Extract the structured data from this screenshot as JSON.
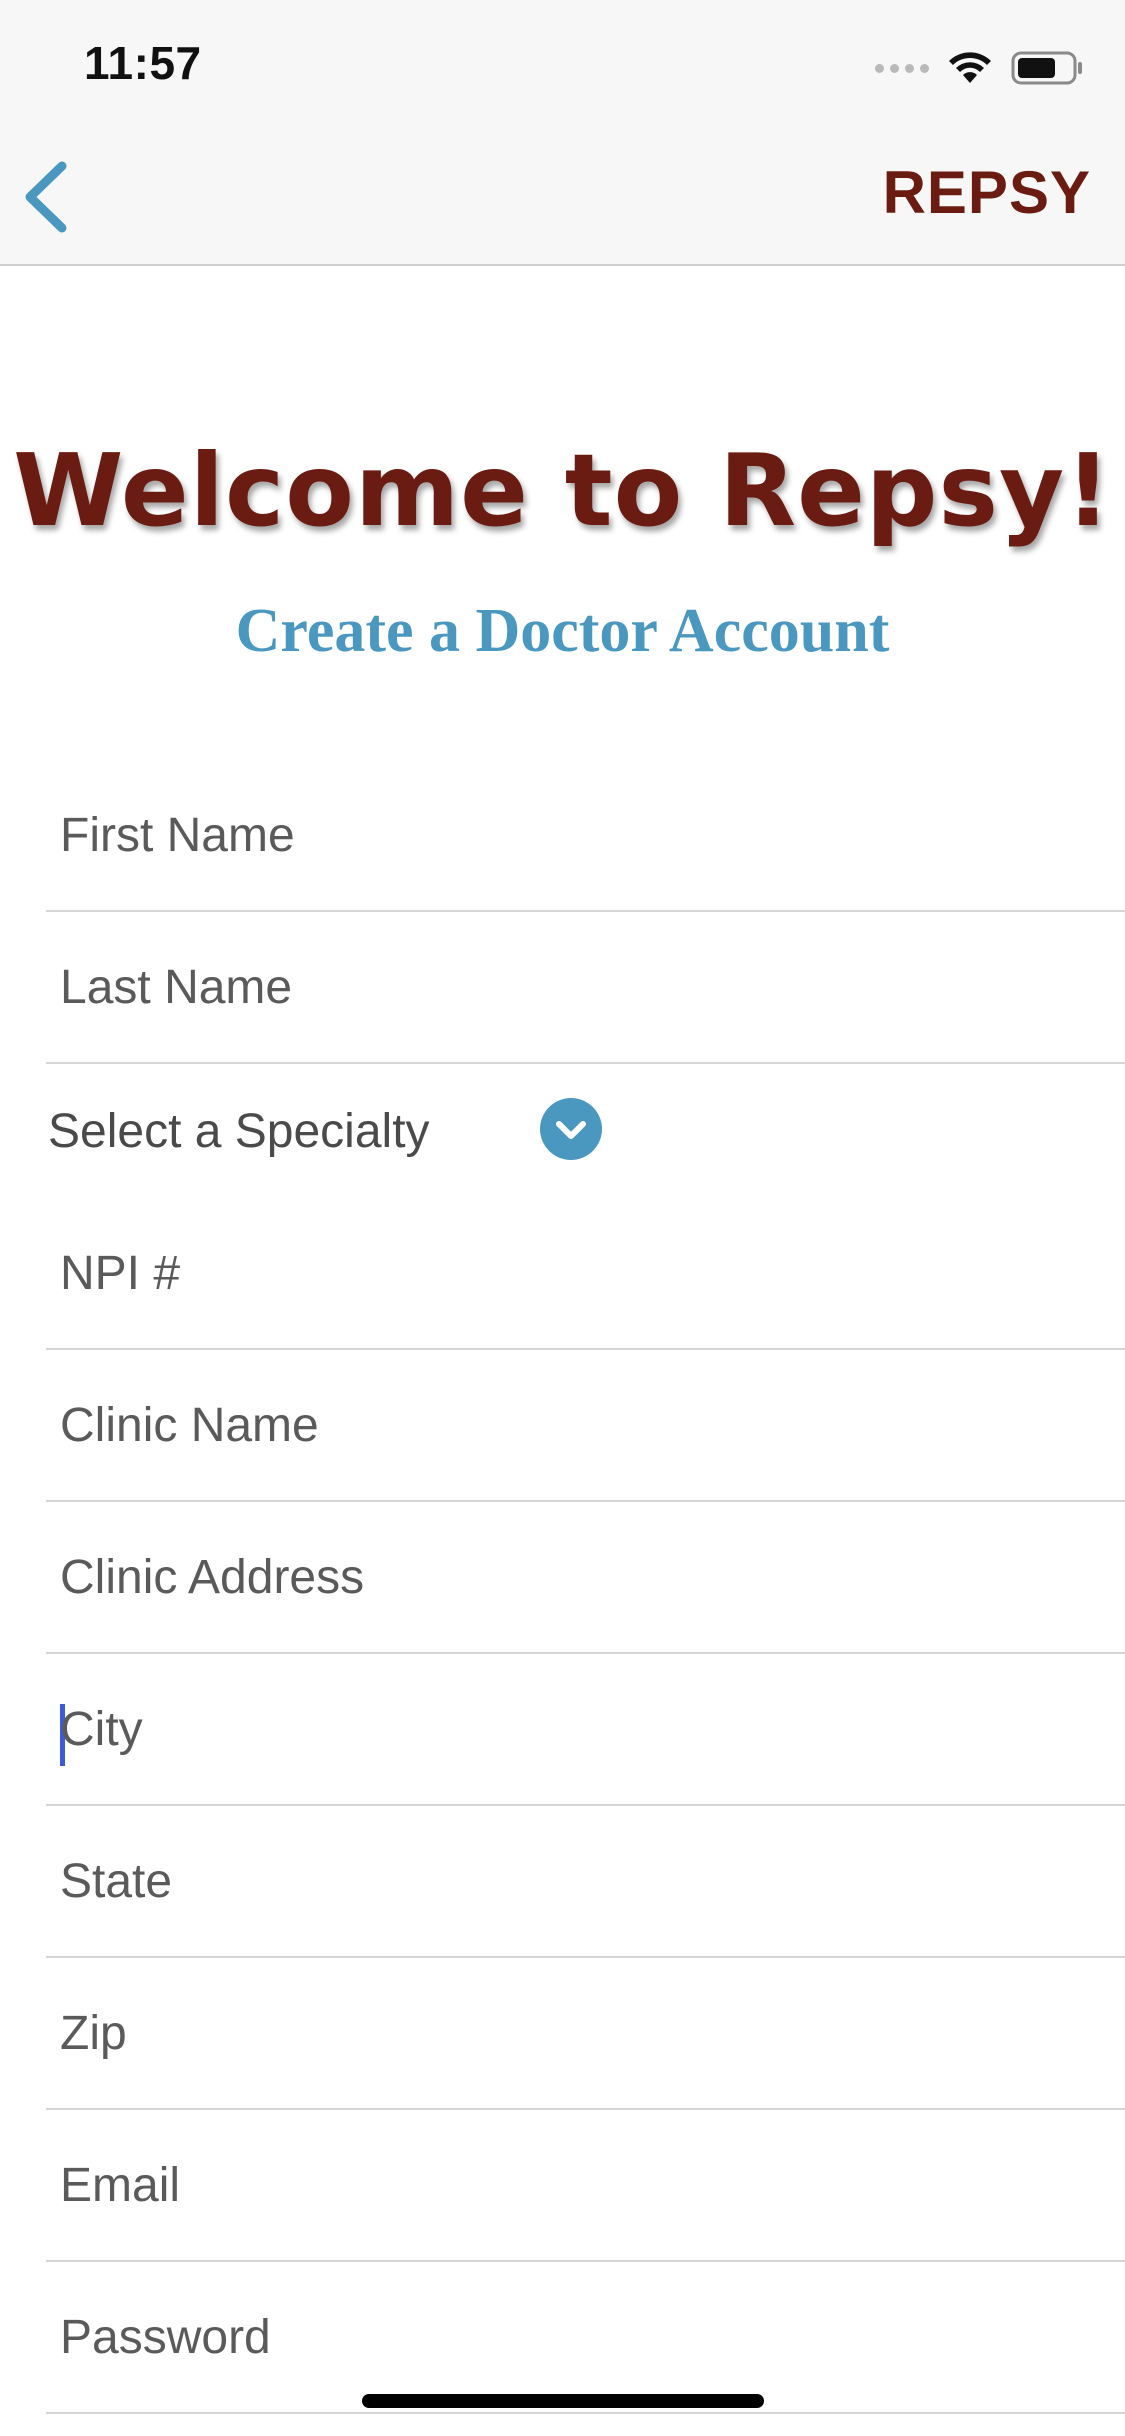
{
  "status_bar": {
    "time": "11:57"
  },
  "nav": {
    "back_icon": "chevron-left-icon",
    "title": "REPSY"
  },
  "header": {
    "title": "Welcome to Repsy!",
    "subtitle": "Create a Doctor Account"
  },
  "form": {
    "first_name_placeholder": "First Name",
    "last_name_placeholder": "Last Name",
    "specialty_label": "Select a Specialty",
    "npi_placeholder": "NPI #",
    "clinic_name_placeholder": "Clinic Name",
    "clinic_address_placeholder": "Clinic Address",
    "city_placeholder": "City",
    "state_placeholder": "State",
    "zip_placeholder": "Zip",
    "email_placeholder": "Email",
    "password_placeholder": "Password"
  },
  "colors": {
    "brand_maroon": "#6b1c12",
    "accent_blue": "#4a97bf",
    "cursor_blue": "#3b5bd6"
  }
}
